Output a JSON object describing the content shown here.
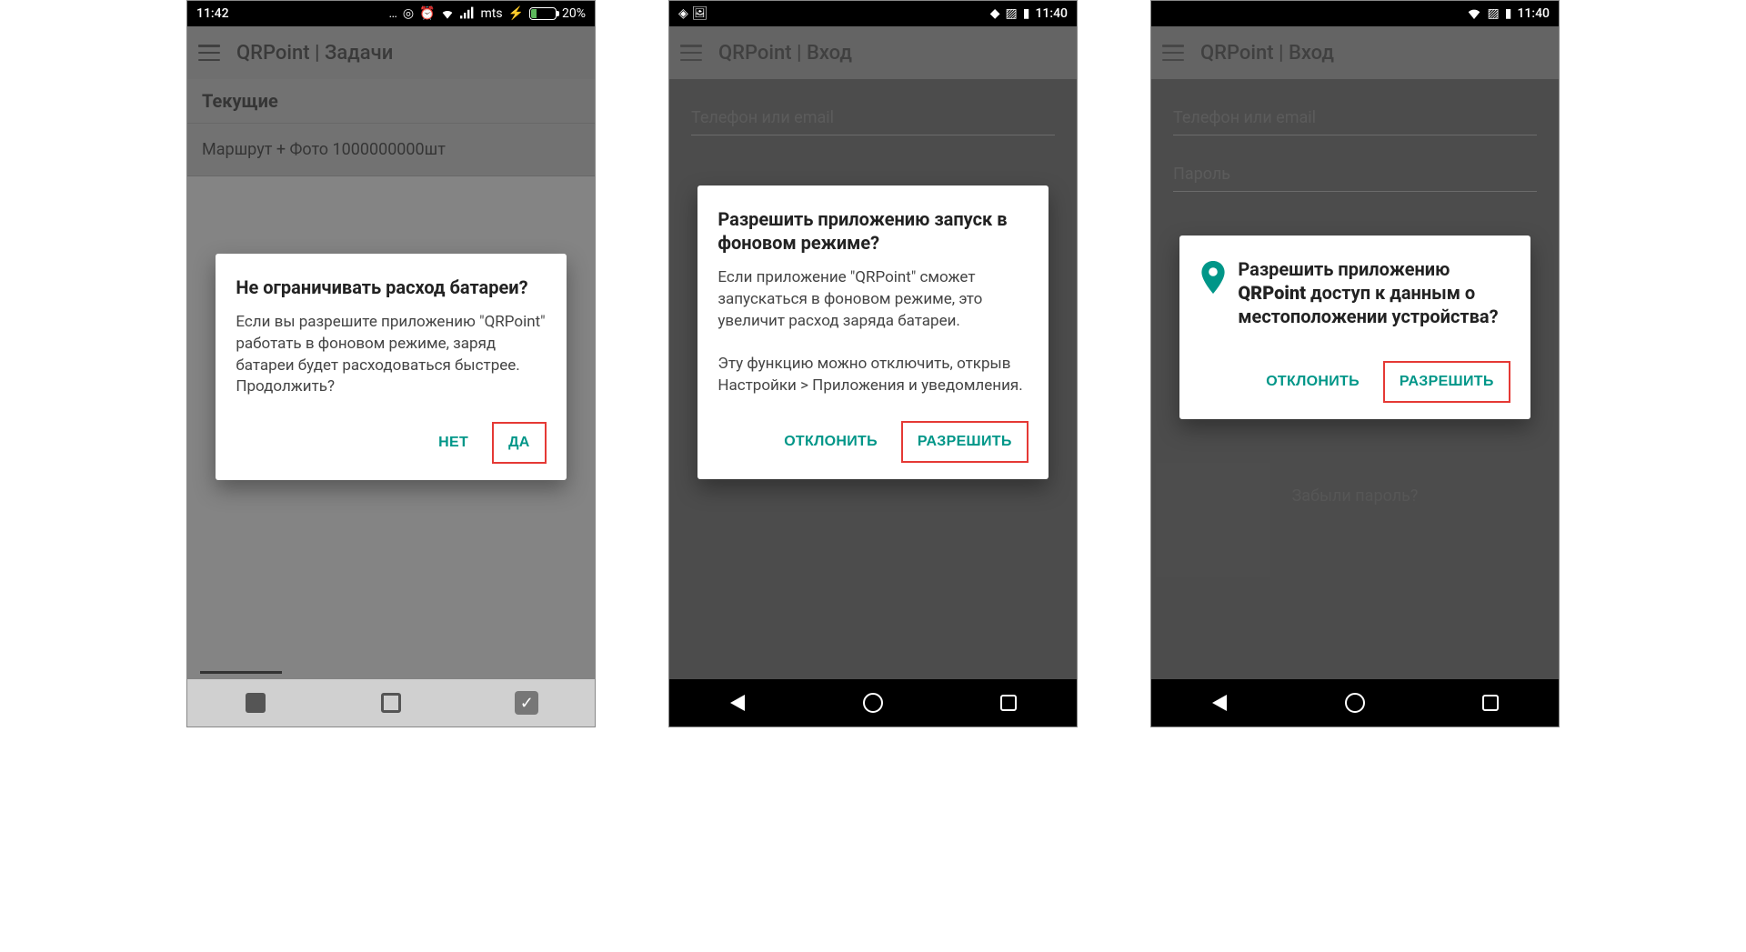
{
  "screen1": {
    "statusbar": {
      "time": "11:42",
      "carrier": "mts",
      "battery_pct": "20%"
    },
    "appbar_title": "QRPoint | Задачи",
    "section_header": "Текущие",
    "list_item": "Маршрут + Фото 1000000000шт",
    "dialog": {
      "title": "Не ограничивать расход батареи?",
      "body": "Если вы разрешите приложению \"QRPoint\" работать в фоновом режиме, заряд батареи будет расходоваться быстрее. Продолжить?",
      "negative": "НЕТ",
      "positive": "ДА"
    }
  },
  "screen2": {
    "statusbar": {
      "time": "11:40"
    },
    "appbar_title": "QRPoint | Вход",
    "field_phone": "Телефон или email",
    "dialog": {
      "title": "Разрешить приложению запуск в фоновом режиме?",
      "body": "Если приложение \"QRPoint\" сможет запускаться в фоновом режиме, это увеличит расход заряда батареи.\n\nЭту функцию можно отключить, открыв Настройки > Приложения и уведомления.",
      "negative": "ОТКЛОНИТЬ",
      "positive": "РАЗРЕШИТЬ"
    }
  },
  "screen3": {
    "statusbar": {
      "time": "11:40"
    },
    "appbar_title": "QRPoint | Вход",
    "field_phone": "Телефон или email",
    "field_password": "Пароль",
    "forgot": "Забыли пароль?",
    "dialog": {
      "title_prefix": "Разрешить приложению ",
      "app_name": "QRPoint",
      "title_suffix": " доступ к данным о местоположении устройства?",
      "negative": "ОТКЛОНИТЬ",
      "positive": "РАЗРЕШИТЬ"
    }
  }
}
